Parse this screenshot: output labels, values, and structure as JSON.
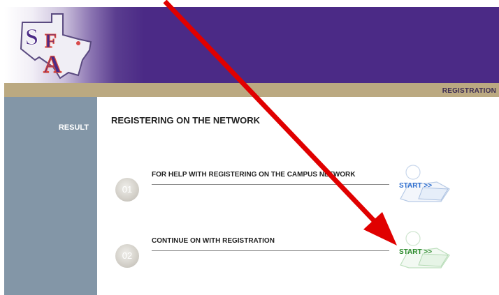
{
  "header": {
    "logo_text": "SFA",
    "registration_label": "REGISTRATION"
  },
  "sidebar": {
    "result_label": "RESULT"
  },
  "main": {
    "title": "REGISTERING ON THE NETWORK",
    "steps": [
      {
        "number": "01",
        "label": "FOR HELP WITH REGISTERING ON THE CAMPUS NETWORK",
        "button": "START >>",
        "color": "#2f6fcf"
      },
      {
        "number": "02",
        "label": "CONTINUE ON WITH REGISTRATION",
        "button": "START >>",
        "color": "#2b8a2b"
      }
    ]
  },
  "annotation": {
    "color": "#e00000",
    "icon": "red-arrow-icon"
  },
  "colors": {
    "header_purple": "#4b2a86",
    "tan_bar": "#bba981",
    "sidebar": "#8396a7"
  }
}
